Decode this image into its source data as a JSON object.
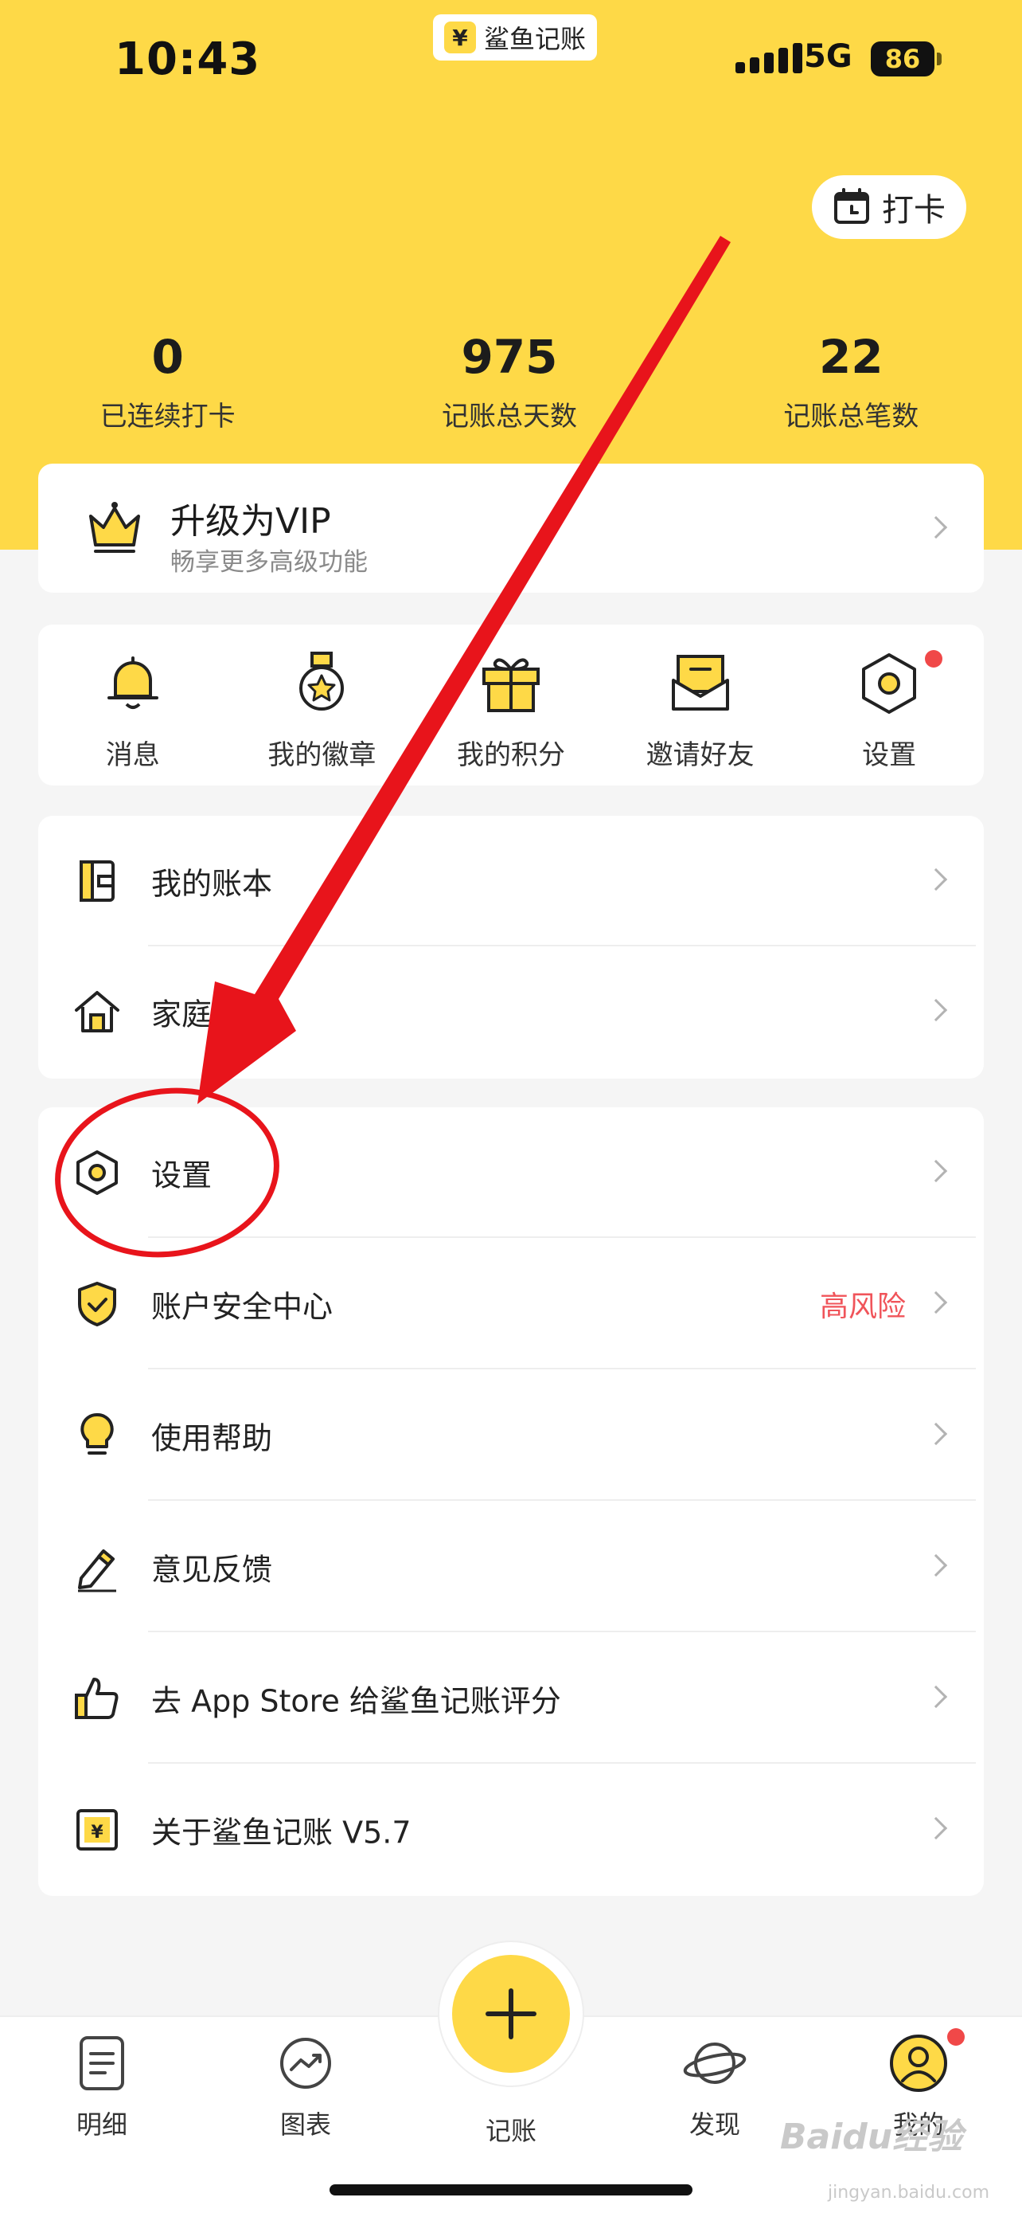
{
  "status_bar": {
    "time": "10:43",
    "app_badge_icon": "¥",
    "app_badge_label": "鲨鱼记账",
    "network": "5G",
    "battery": "86"
  },
  "header": {
    "checkin_label": "打卡",
    "stats": [
      {
        "value": "0",
        "label": "已连续打卡"
      },
      {
        "value": "975",
        "label": "记账总天数"
      },
      {
        "value": "22",
        "label": "记账总笔数"
      }
    ]
  },
  "vip": {
    "title": "升级为VIP",
    "subtitle": "畅享更多高级功能"
  },
  "quick_actions": [
    {
      "label": "消息",
      "icon": "bell-icon"
    },
    {
      "label": "我的徽章",
      "icon": "medal-icon"
    },
    {
      "label": "我的积分",
      "icon": "gift-icon"
    },
    {
      "label": "邀请好友",
      "icon": "envelope-icon"
    },
    {
      "label": "设置",
      "icon": "hexagon-settings-icon",
      "badge_dot": true
    }
  ],
  "book_list": [
    {
      "label": "我的账本",
      "icon": "wallet-icon"
    },
    {
      "label": "家庭账单",
      "icon": "house-icon"
    }
  ],
  "settings_list": [
    {
      "label": "设置",
      "icon": "hexagon-settings-icon"
    },
    {
      "label": "账户安全中心",
      "icon": "shield-check-icon",
      "value": "高风险"
    },
    {
      "label": "使用帮助",
      "icon": "lightbulb-icon"
    },
    {
      "label": "意见反馈",
      "icon": "pencil-icon"
    },
    {
      "label": "去 App Store 给鲨鱼记账评分",
      "icon": "thumbs-up-icon"
    },
    {
      "label": "关于鲨鱼记账 V5.7",
      "icon": "yen-box-icon"
    }
  ],
  "tabbar": {
    "tabs": [
      {
        "label": "明细",
        "icon": "list-doc-icon"
      },
      {
        "label": "图表",
        "icon": "chart-trend-icon"
      },
      {
        "label": "记账",
        "icon": "plus-icon"
      },
      {
        "label": "发现",
        "icon": "planet-icon"
      },
      {
        "label": "我的",
        "icon": "user-icon",
        "badge_dot": true
      }
    ]
  },
  "watermark": {
    "text": "Baidu经验",
    "sub": "jingyan.baidu.com"
  },
  "colors": {
    "brand_yellow": "#fed947",
    "alert_red": "#f0545a",
    "annotation_red": "#e8141b"
  }
}
